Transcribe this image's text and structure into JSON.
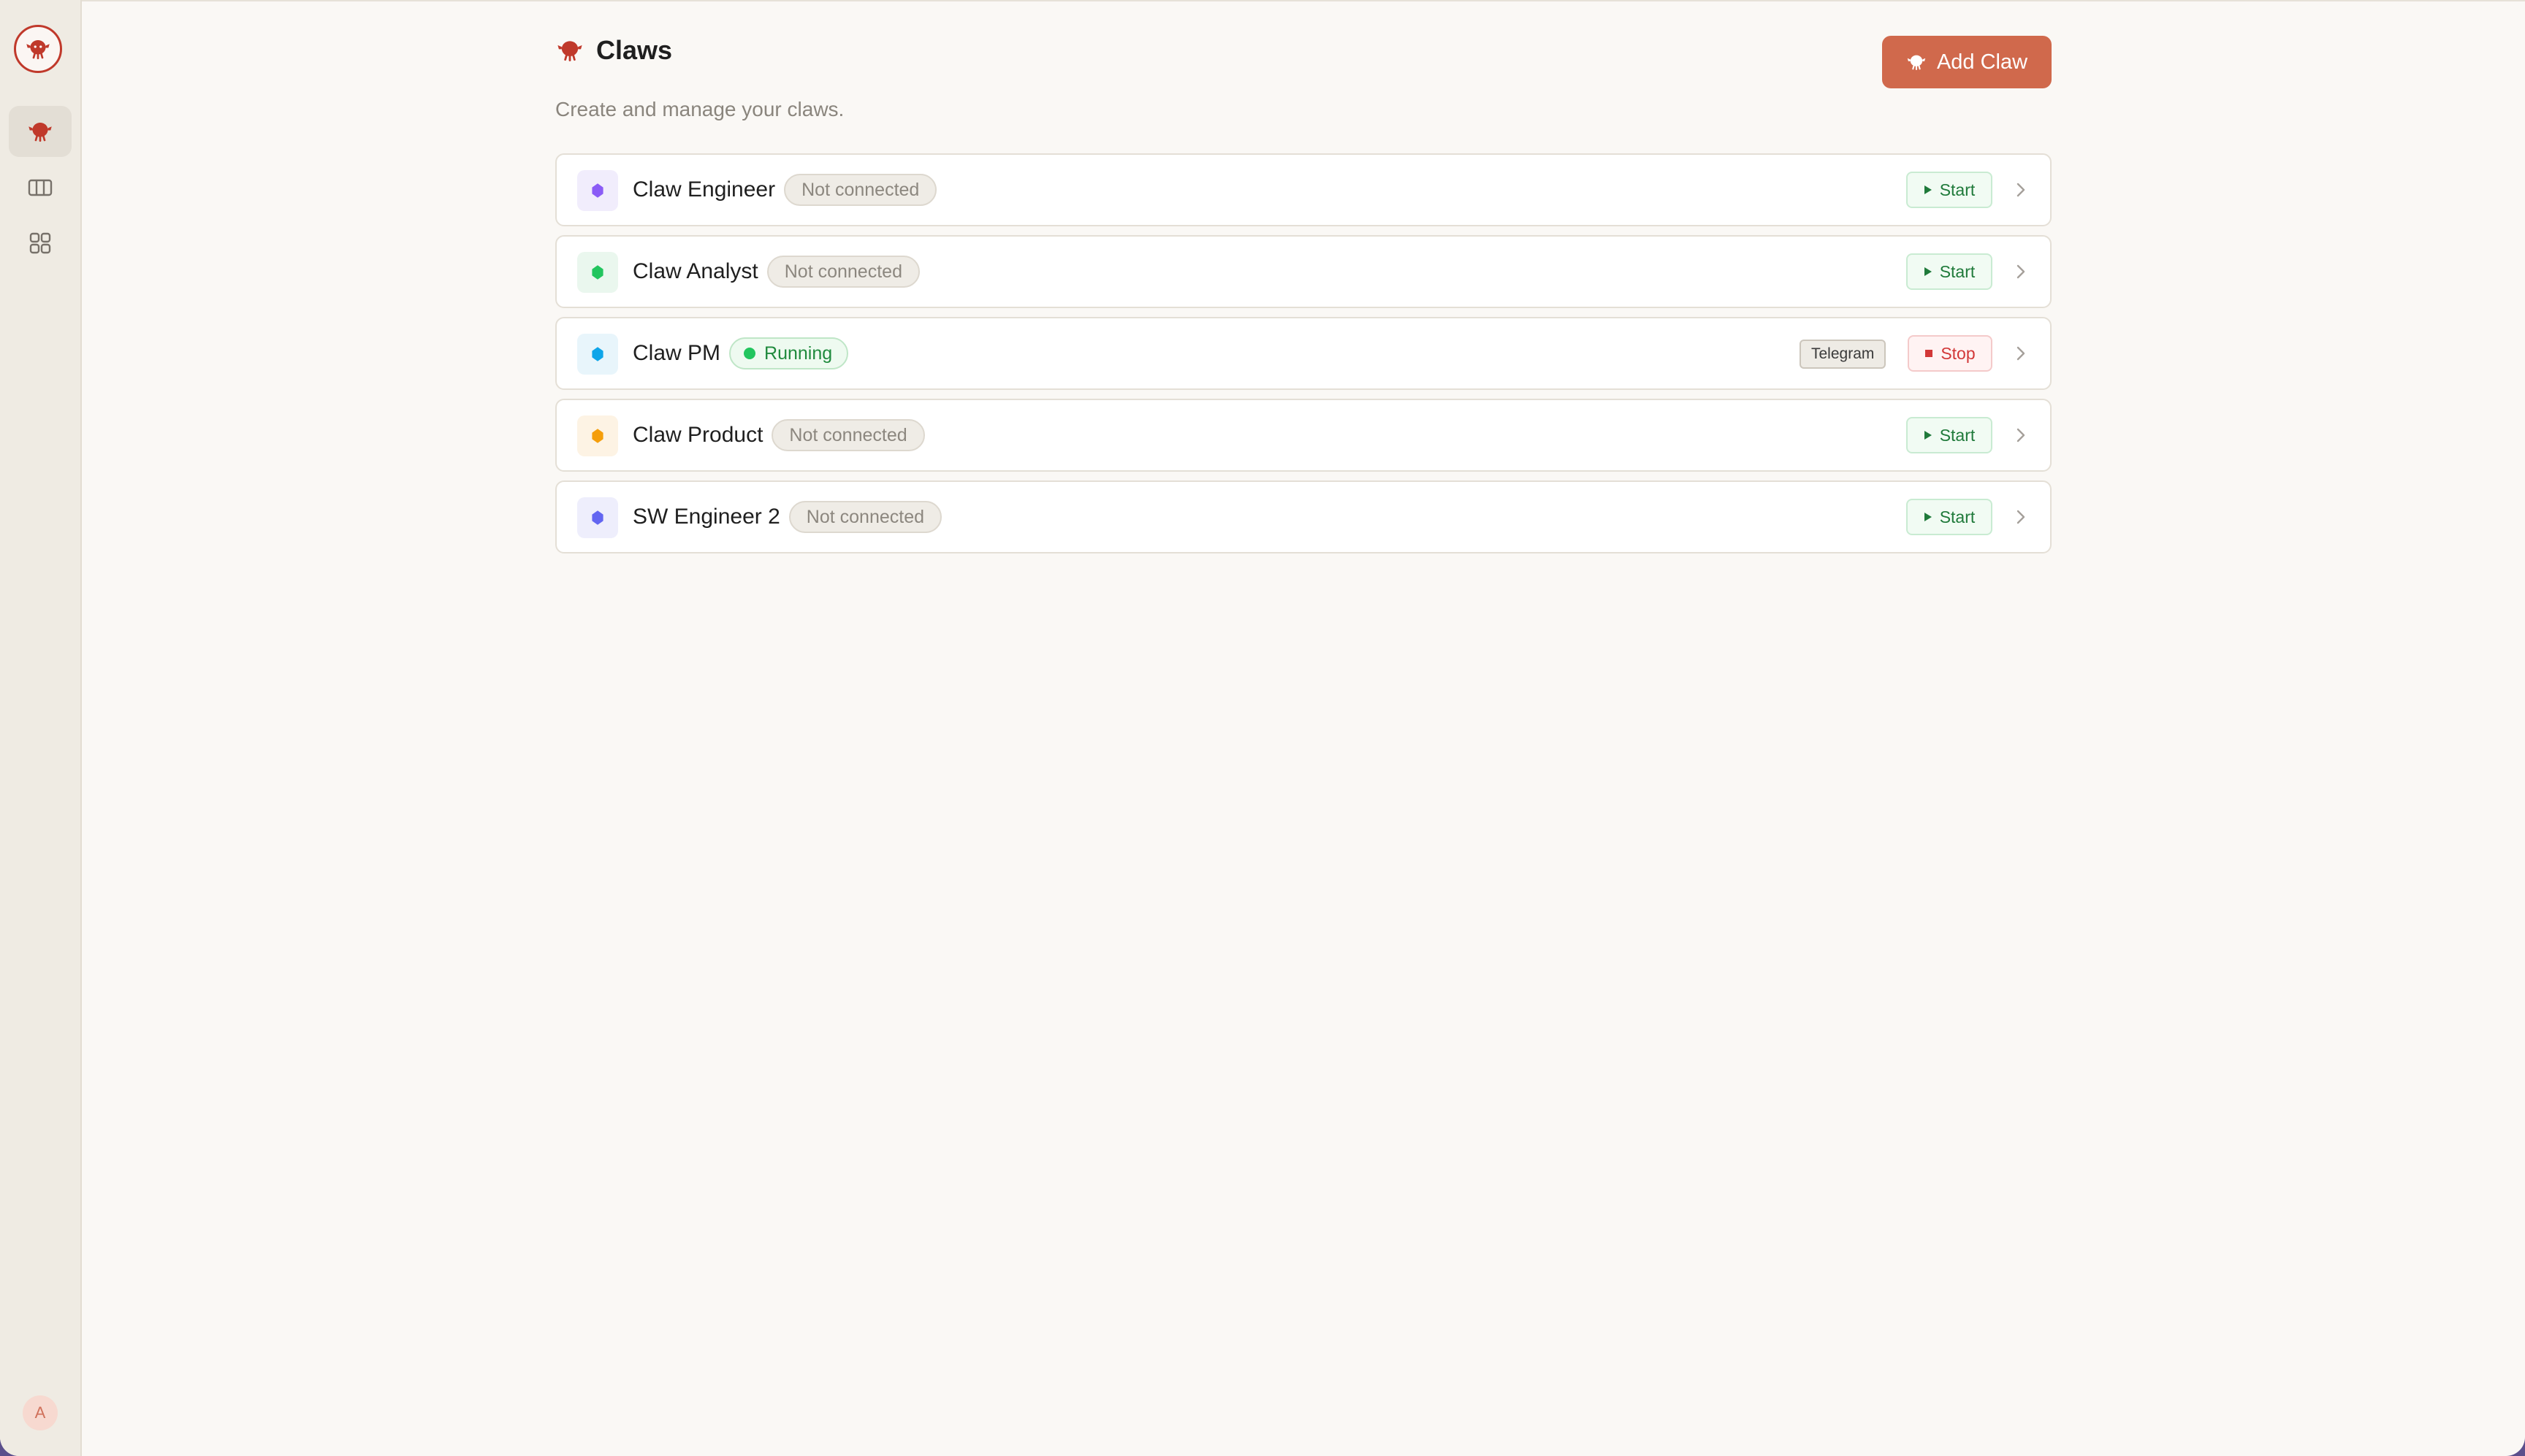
{
  "header": {
    "title": "Claws",
    "subtitle": "Create and manage your claws.",
    "add_button": "Add Claw"
  },
  "sidebar": {
    "items": [
      {
        "icon": "claw-icon",
        "active": true
      },
      {
        "icon": "columns-icon",
        "active": false
      },
      {
        "icon": "grid-icon",
        "active": false
      }
    ],
    "avatar_initial": "A"
  },
  "claws": [
    {
      "name": "Claw Engineer",
      "status": "Not connected",
      "action": "Start",
      "icon_color": "#8b5cf6",
      "icon_bg": "#f1edfc"
    },
    {
      "name": "Claw Analyst",
      "status": "Not connected",
      "action": "Start",
      "icon_color": "#22c55e",
      "icon_bg": "#eaf7ee"
    },
    {
      "name": "Claw PM",
      "status": "Running",
      "channel": "Telegram",
      "action": "Stop",
      "icon_color": "#0ea5e9",
      "icon_bg": "#e8f5fb"
    },
    {
      "name": "Claw Product",
      "status": "Not connected",
      "action": "Start",
      "icon_color": "#f59e0b",
      "icon_bg": "#fdf3e4"
    },
    {
      "name": "SW Engineer 2",
      "status": "Not connected",
      "action": "Start",
      "icon_color": "#6366f1",
      "icon_bg": "#eeeefc"
    }
  ],
  "colors": {
    "accent": "#d0694c",
    "brand_red": "#c0392b",
    "running_green": "#22c55e",
    "stop_red": "#d23838"
  }
}
